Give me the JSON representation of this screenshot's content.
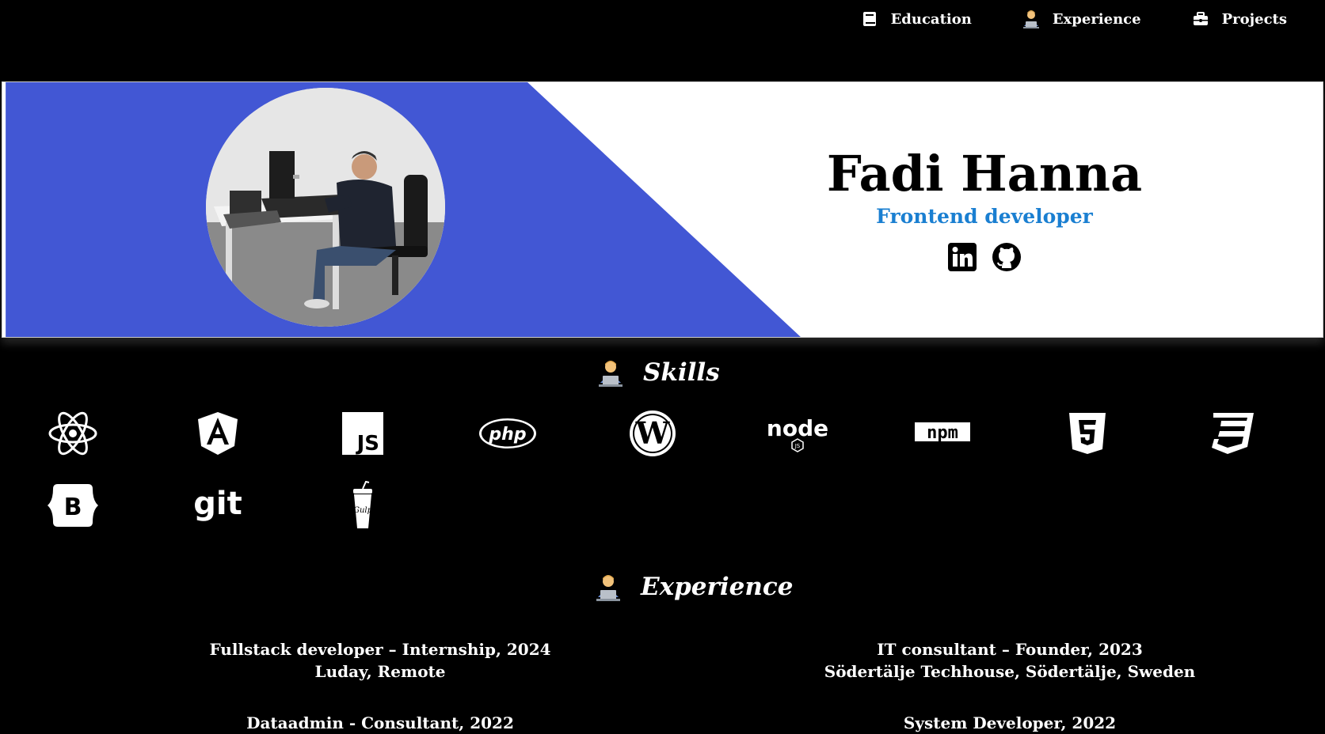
{
  "nav": {
    "items": [
      {
        "label": "Education",
        "icon": "book-icon"
      },
      {
        "label": "Experience",
        "icon": "technologist-icon"
      },
      {
        "label": "Projects",
        "icon": "briefcase-icon"
      }
    ]
  },
  "hero": {
    "name": "Fadi Hanna",
    "role": "Frontend developer",
    "accent": "#4257d4",
    "role_color": "#1a7fd1",
    "social": [
      "linkedin-icon",
      "github-icon"
    ]
  },
  "skills": {
    "title": "Skills",
    "items": [
      "react-icon",
      "angular-icon",
      "javascript-icon",
      "php-icon",
      "wordpress-icon",
      "nodejs-icon",
      "npm-icon",
      "html5-icon",
      "css3-icon",
      "bootstrap-icon",
      "git-icon",
      "gulp-icon"
    ]
  },
  "experience": {
    "title": "Experience",
    "items": [
      {
        "role": "Fullstack developer – Internship, 2024",
        "place": "Luday, Remote"
      },
      {
        "role": "IT consultant – Founder, 2023",
        "place": "Södertälje Techhouse, Södertälje, Sweden"
      },
      {
        "role": "Dataadmin - Consultant, 2022",
        "place": ""
      },
      {
        "role": "System Developer, 2022",
        "place": ""
      }
    ]
  }
}
